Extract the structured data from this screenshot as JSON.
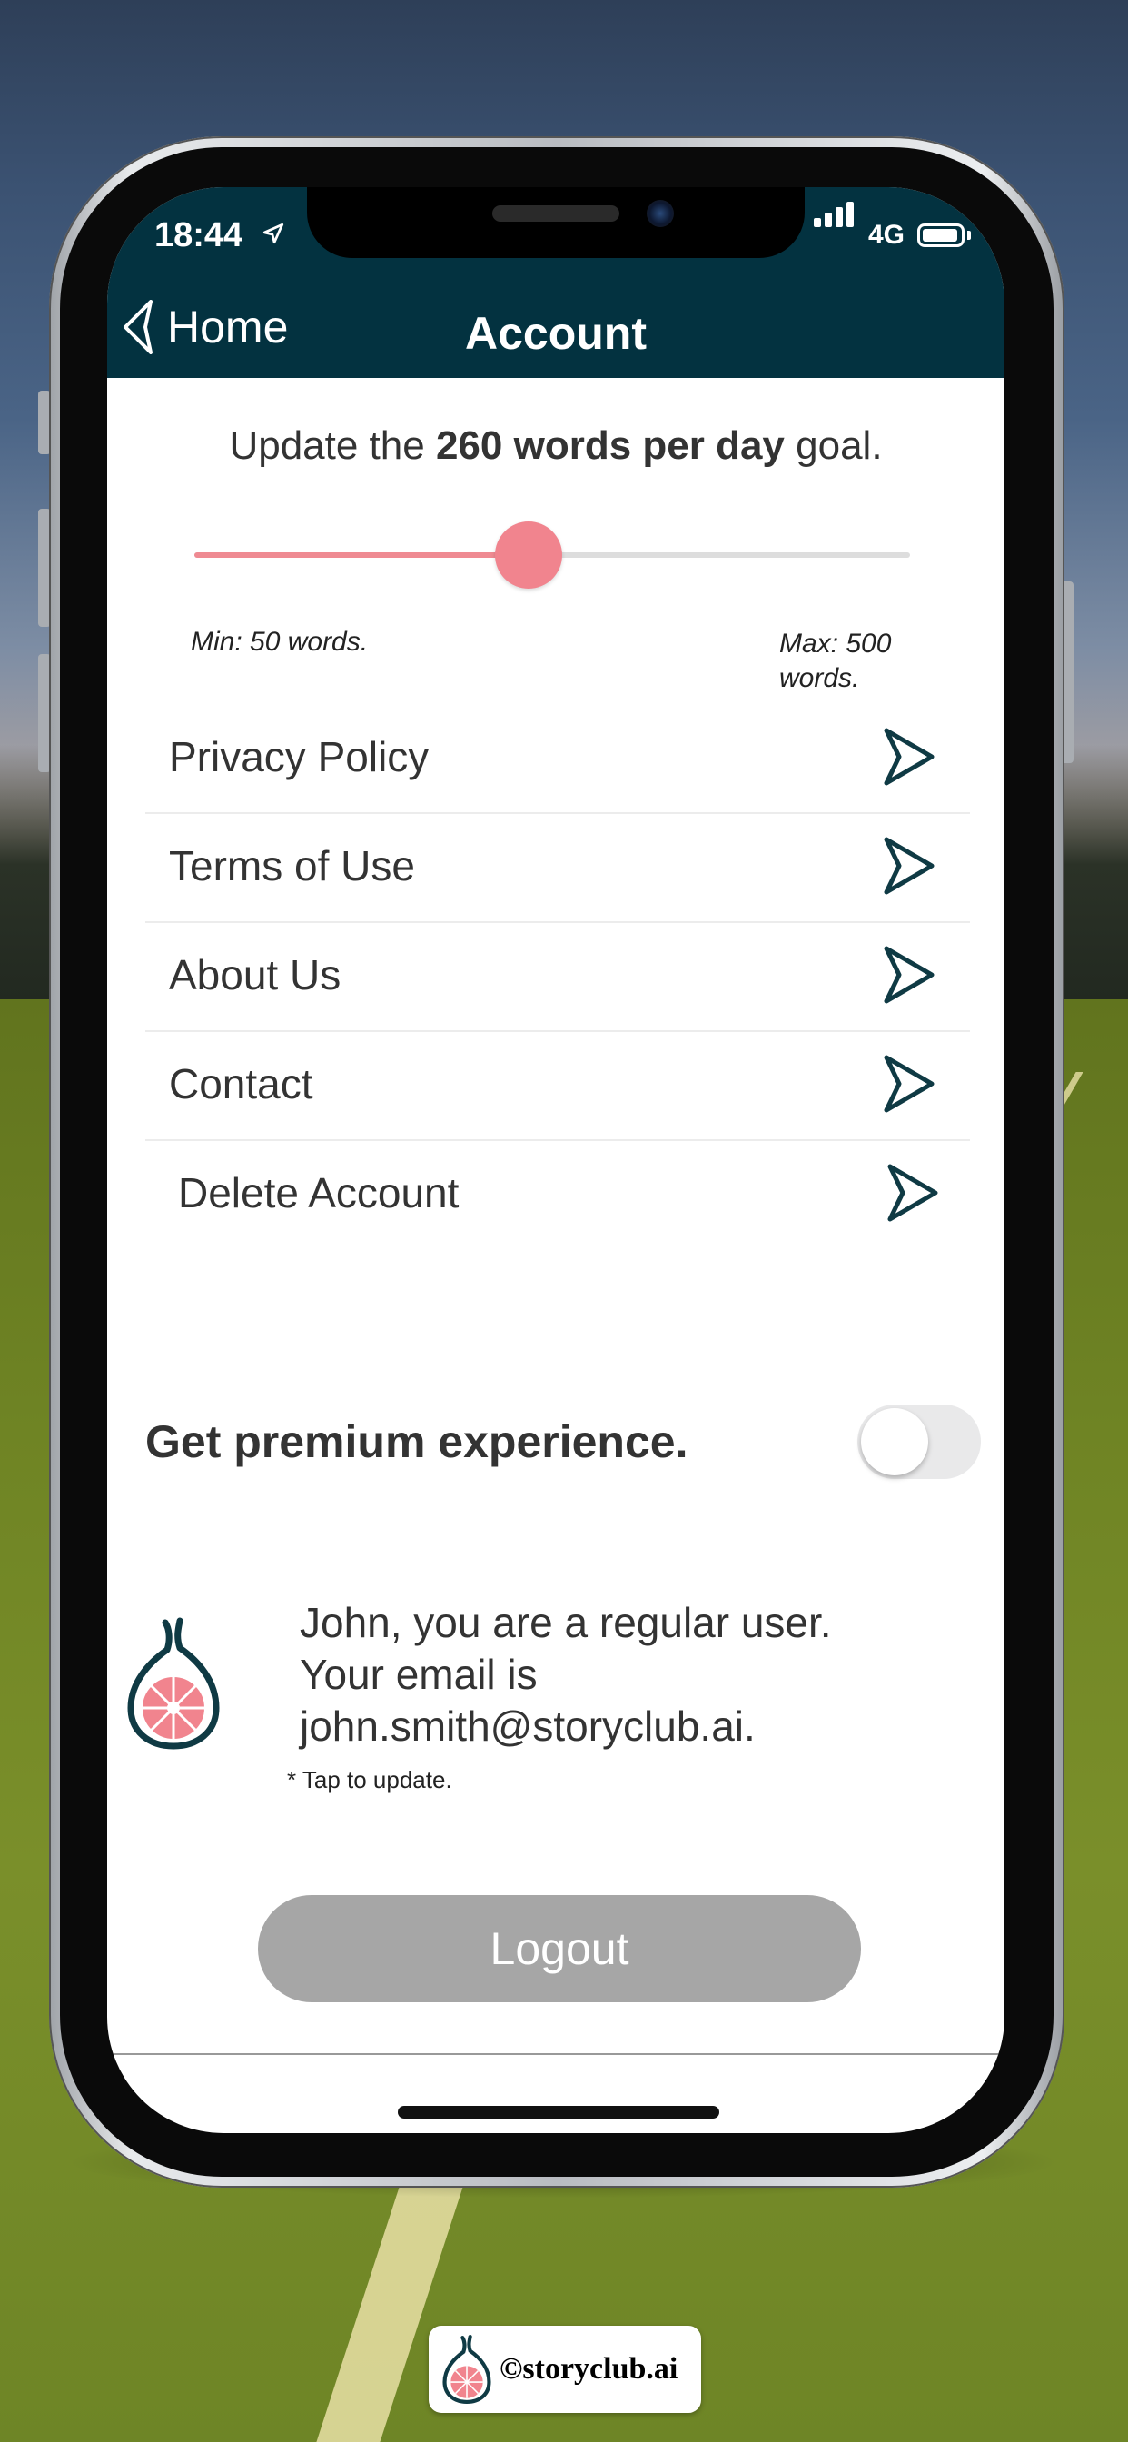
{
  "status_bar": {
    "time": "18:44",
    "network": "4G"
  },
  "nav": {
    "back_label": "Home",
    "title": "Account"
  },
  "goal": {
    "prefix": "Update the ",
    "emphasis": "260 words per day",
    "suffix": " goal."
  },
  "slider": {
    "min_label": "Min: 50 words.",
    "max_label": "Max: 500 words.",
    "min": 50,
    "max": 500,
    "value": 260
  },
  "menu": {
    "items": [
      {
        "label": "Privacy Policy"
      },
      {
        "label": "Terms of Use"
      },
      {
        "label": "About Us"
      },
      {
        "label": "Contact"
      },
      {
        "label": "Delete Account"
      }
    ]
  },
  "premium": {
    "label": "Get premium experience.",
    "enabled": false
  },
  "user": {
    "message": "John, you are a regular user. Your email is john.smith@storyclub.ai.",
    "note": "* Tap to update."
  },
  "logout": {
    "label": "Logout"
  },
  "watermark": {
    "text": "©storyclub.ai"
  },
  "colors": {
    "nav_bg": "#033240",
    "accent": "#f1848e",
    "chevron": "#0f3a44",
    "logout_bg": "#a6a6a6"
  }
}
